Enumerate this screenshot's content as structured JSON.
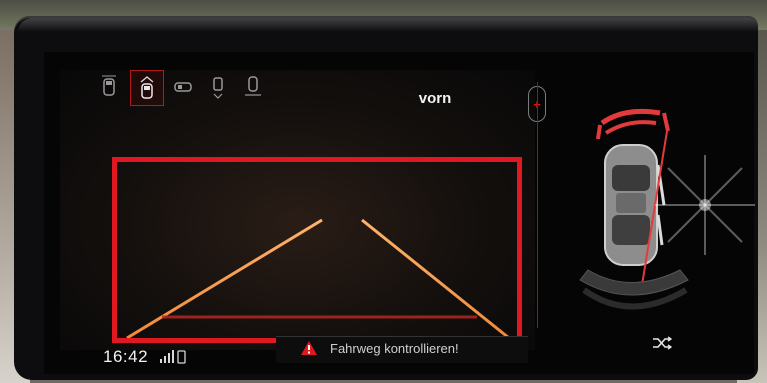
{
  "header": {
    "title": "vorn"
  },
  "view_icons": [
    {
      "name": "rear-view-icon",
      "active": false
    },
    {
      "name": "front-view-icon",
      "active": true
    },
    {
      "name": "side-view-icon",
      "active": false
    },
    {
      "name": "top-view-icon",
      "active": false
    },
    {
      "name": "360-view-icon",
      "active": false
    }
  ],
  "side_button": {
    "symbol": "+"
  },
  "status": {
    "time": "16:42"
  },
  "warning": {
    "text": "Fahrweg kontrollieren!"
  },
  "colors": {
    "accent": "#e0181f",
    "guide_line": "#e87a3a",
    "sensor_arc": "#e33b3b"
  }
}
